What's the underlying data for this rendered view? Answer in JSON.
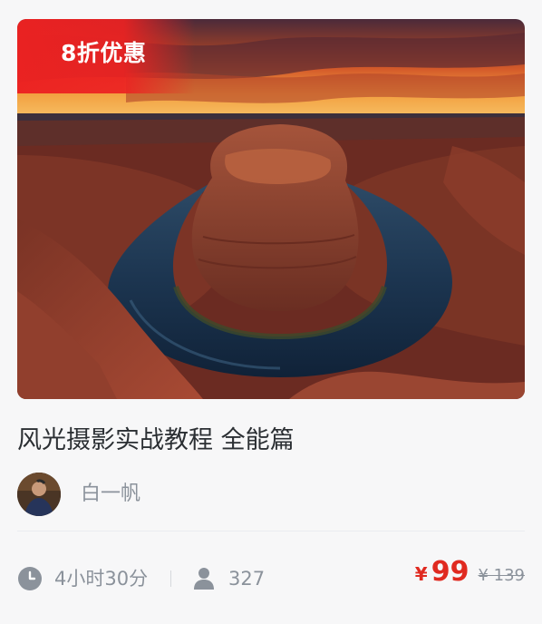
{
  "course": {
    "badge": "8折优惠",
    "title": "风光摄影实战教程 全能篇",
    "cover_alt": "Horseshoe Bend canyon landscape at sunset",
    "author": {
      "name": "白一帆",
      "avatar_icon": "user-avatar"
    },
    "duration": "4小时30分",
    "students": "327",
    "price": {
      "currency": "¥",
      "current": "99",
      "original": "¥ 139"
    }
  },
  "icons": {
    "duration": "clock-icon",
    "students": "person-icon"
  },
  "colors": {
    "badge_red": "#ec2222",
    "price_red": "#e02a20",
    "muted_text": "#8b929b",
    "title_text": "#2b2f33",
    "background": "#f7f7f8"
  }
}
